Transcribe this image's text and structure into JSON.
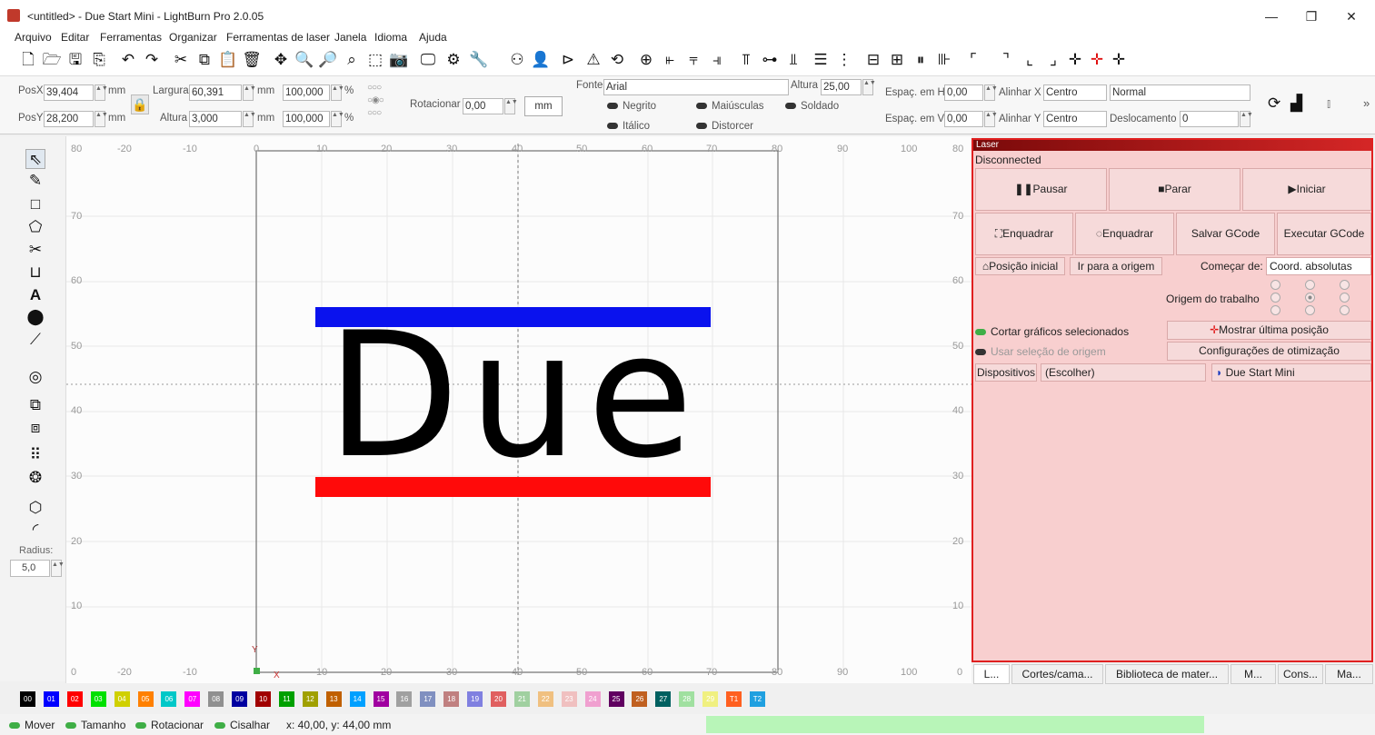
{
  "window": {
    "title": "<untitled> - Due Start Mini - LightBurn Pro 2.0.05",
    "minimize": "—",
    "maximize": "❐",
    "close": "✕"
  },
  "menu": [
    "Arquivo",
    "Editar",
    "Ferramentas",
    "Organizar",
    "Ferramentas de laser",
    "Janela",
    "Idioma",
    "Ajuda"
  ],
  "props": {
    "posx_label": "PosX",
    "posx": "39,404",
    "posy_label": "PosY",
    "posy": "28,200",
    "unit": "mm",
    "largura_label": "Largura",
    "largura": "60,391",
    "altura_label": "Altura",
    "altura": "3,000",
    "pct1": "100,000",
    "pct2": "100,000",
    "pct": "%",
    "rot_label": "Rotacionar",
    "rot": "0,00",
    "mm_button": "mm",
    "fonte_label": "Fonte",
    "fonte": "Arial",
    "alturaf_label": "Altura",
    "alturaf": "25,00",
    "negrito": "Negrito",
    "italico": "Itálico",
    "maiusculas": "Maiúsculas",
    "distorcer": "Distorcer",
    "soldado": "Soldado",
    "espach_label": "Espaç. em H",
    "espach": "0,00",
    "espacv_label": "Espaç. em V",
    "espacv": "0,00",
    "alinx_label": "Alinhar X",
    "alinx": "Centro",
    "aliny_label": "Alinhar Y",
    "aliny": "Centro",
    "estilo": "Normal",
    "desloc_label": "Deslocamento",
    "desloc": "0"
  },
  "canvas": {
    "x_labels": [
      "-20",
      "-10",
      "0",
      "10",
      "20",
      "30",
      "40",
      "50",
      "60",
      "70",
      "80",
      "90",
      "100"
    ],
    "y_labels": [
      "80",
      "70",
      "60",
      "50",
      "40",
      "30",
      "20",
      "10",
      "0"
    ],
    "logo_text": "Due",
    "colors": {
      "top_bar": "#0a12ee",
      "bottom_bar": "#ff0a0a",
      "logo": "#000000"
    },
    "origin_x": "X",
    "origin_y": "Y"
  },
  "left": {
    "radius_label": "Radius:",
    "radius": "5,0"
  },
  "laser": {
    "title": "Laser",
    "status": "Disconnected",
    "pausar": "Pausar",
    "parar": "Parar",
    "iniciar": "Iniciar",
    "enquadrar1": "Enquadrar",
    "enquadrar2": "Enquadrar",
    "salvar": "Salvar GCode",
    "executar": "Executar GCode",
    "home": "Posição inicial",
    "origem": "Ir para a origem",
    "comecar_label": "Começar de:",
    "comecar": "Coord. absolutas",
    "origem_trabalho": "Origem do trabalho",
    "cortar": "Cortar gráficos selecionados",
    "mostrar": "Mostrar última posição",
    "usar": "Usar seleção de origem",
    "config": "Configurações de otimização",
    "dispositivos": "Dispositivos",
    "escolher": "(Escolher)",
    "device": "Due Start Mini"
  },
  "tabs": [
    "L...",
    "Cortes/cama...",
    "Biblioteca de mater...",
    "M...",
    "Cons...",
    "Ma..."
  ],
  "palette": [
    {
      "id": "00",
      "color": "#000000"
    },
    {
      "id": "01",
      "color": "#0000ff"
    },
    {
      "id": "02",
      "color": "#ff0000"
    },
    {
      "id": "03",
      "color": "#00e000"
    },
    {
      "id": "04",
      "color": "#d0d000"
    },
    {
      "id": "05",
      "color": "#ff8000"
    },
    {
      "id": "06",
      "color": "#00c8c8"
    },
    {
      "id": "07",
      "color": "#ff00ff"
    },
    {
      "id": "08",
      "color": "#909090"
    },
    {
      "id": "09",
      "color": "#0000a0"
    },
    {
      "id": "10",
      "color": "#a00000"
    },
    {
      "id": "11",
      "color": "#00a000"
    },
    {
      "id": "12",
      "color": "#a0a000"
    },
    {
      "id": "13",
      "color": "#c06000"
    },
    {
      "id": "14",
      "color": "#00a0ff"
    },
    {
      "id": "15",
      "color": "#a000a0"
    },
    {
      "id": "16",
      "color": "#a0a0a0"
    },
    {
      "id": "17",
      "color": "#8090c0"
    },
    {
      "id": "18",
      "color": "#c08080"
    },
    {
      "id": "19",
      "color": "#8080e0"
    },
    {
      "id": "20",
      "color": "#e06060"
    },
    {
      "id": "21",
      "color": "#a0d0a0"
    },
    {
      "id": "22",
      "color": "#f0c080"
    },
    {
      "id": "23",
      "color": "#f0c0c0"
    },
    {
      "id": "24",
      "color": "#f0a0d0"
    },
    {
      "id": "25",
      "color": "#600060"
    },
    {
      "id": "26",
      "color": "#c06020"
    },
    {
      "id": "27",
      "color": "#006060"
    },
    {
      "id": "28",
      "color": "#a0e0a0"
    },
    {
      "id": "29",
      "color": "#f0f080"
    },
    {
      "id": "T1",
      "color": "#ff6020"
    },
    {
      "id": "T2",
      "color": "#20a0e0"
    }
  ],
  "status": {
    "mover": "Mover",
    "tamanho": "Tamanho",
    "rotacionar": "Rotacionar",
    "cisalhar": "Cisalhar",
    "coords": "x: 40,00, y: 44,00 mm"
  }
}
